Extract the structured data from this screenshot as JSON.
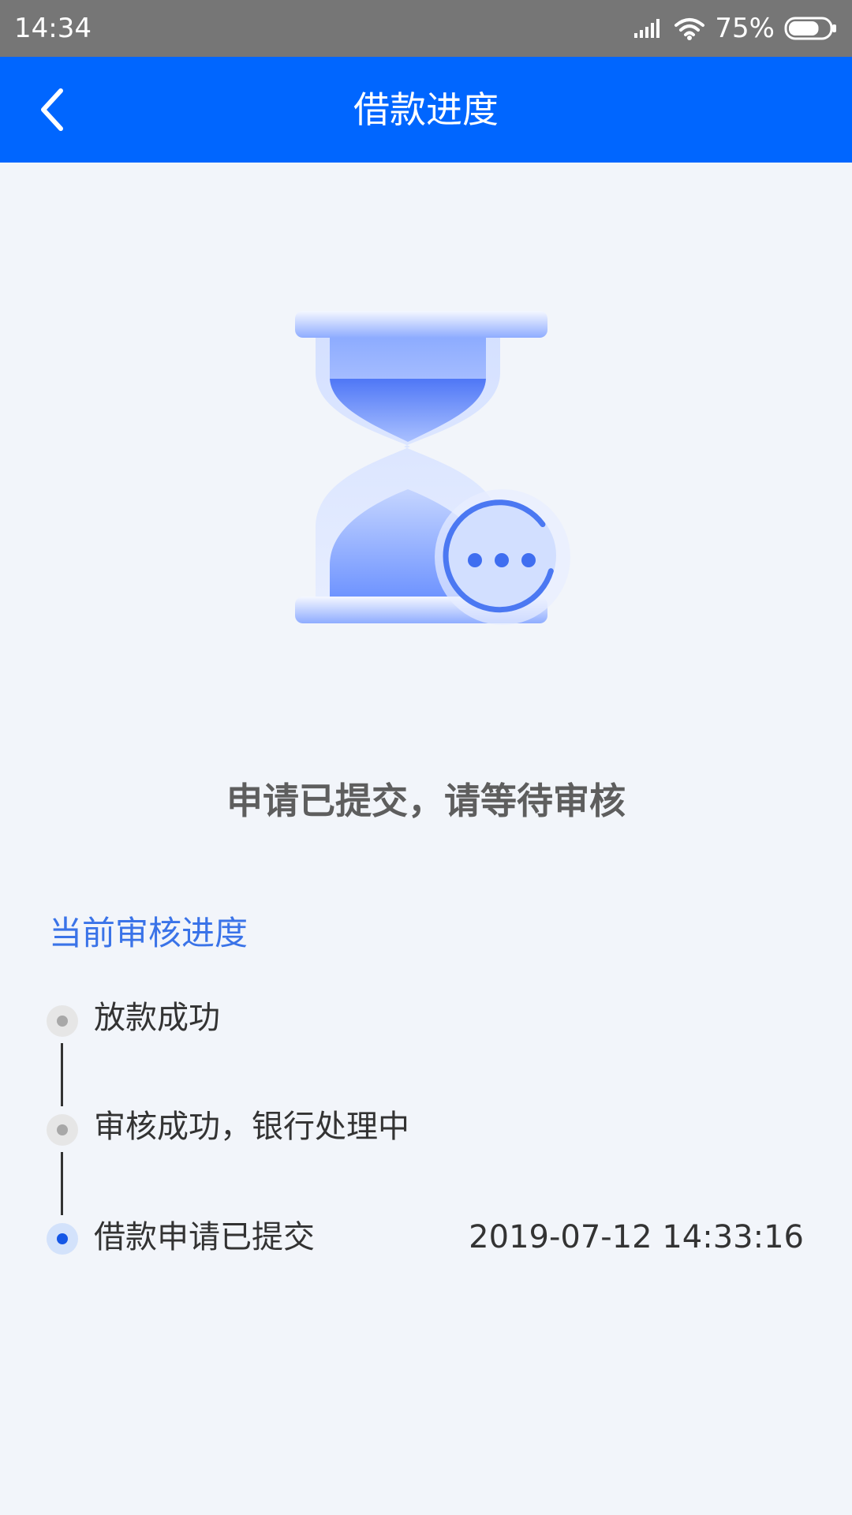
{
  "status_bar": {
    "time": "14:34",
    "battery_percent": "75%",
    "battery_level": 0.75,
    "icons": [
      "signal-icon",
      "wifi-icon",
      "battery-icon"
    ]
  },
  "header": {
    "title": "借款进度",
    "back_icon": "chevron-left-icon"
  },
  "illustration": {
    "icon": "hourglass-pending-icon"
  },
  "status_message": "申请已提交，请等待审核",
  "progress": {
    "title": "当前审核进度",
    "steps": [
      {
        "label": "放款成功",
        "time": "",
        "state": "pending"
      },
      {
        "label": "审核成功，银行处理中",
        "time": "",
        "state": "pending"
      },
      {
        "label": "借款申请已提交",
        "time": "2019-07-12 14:33:16",
        "state": "current"
      }
    ]
  },
  "colors": {
    "header_bg": "#0066ff",
    "accent": "#3a73e8",
    "page_bg": "#f2f5fa",
    "status_bar_bg": "#767676",
    "active_dot": "#1557e6",
    "inactive_dot": "#a8a8a8"
  }
}
